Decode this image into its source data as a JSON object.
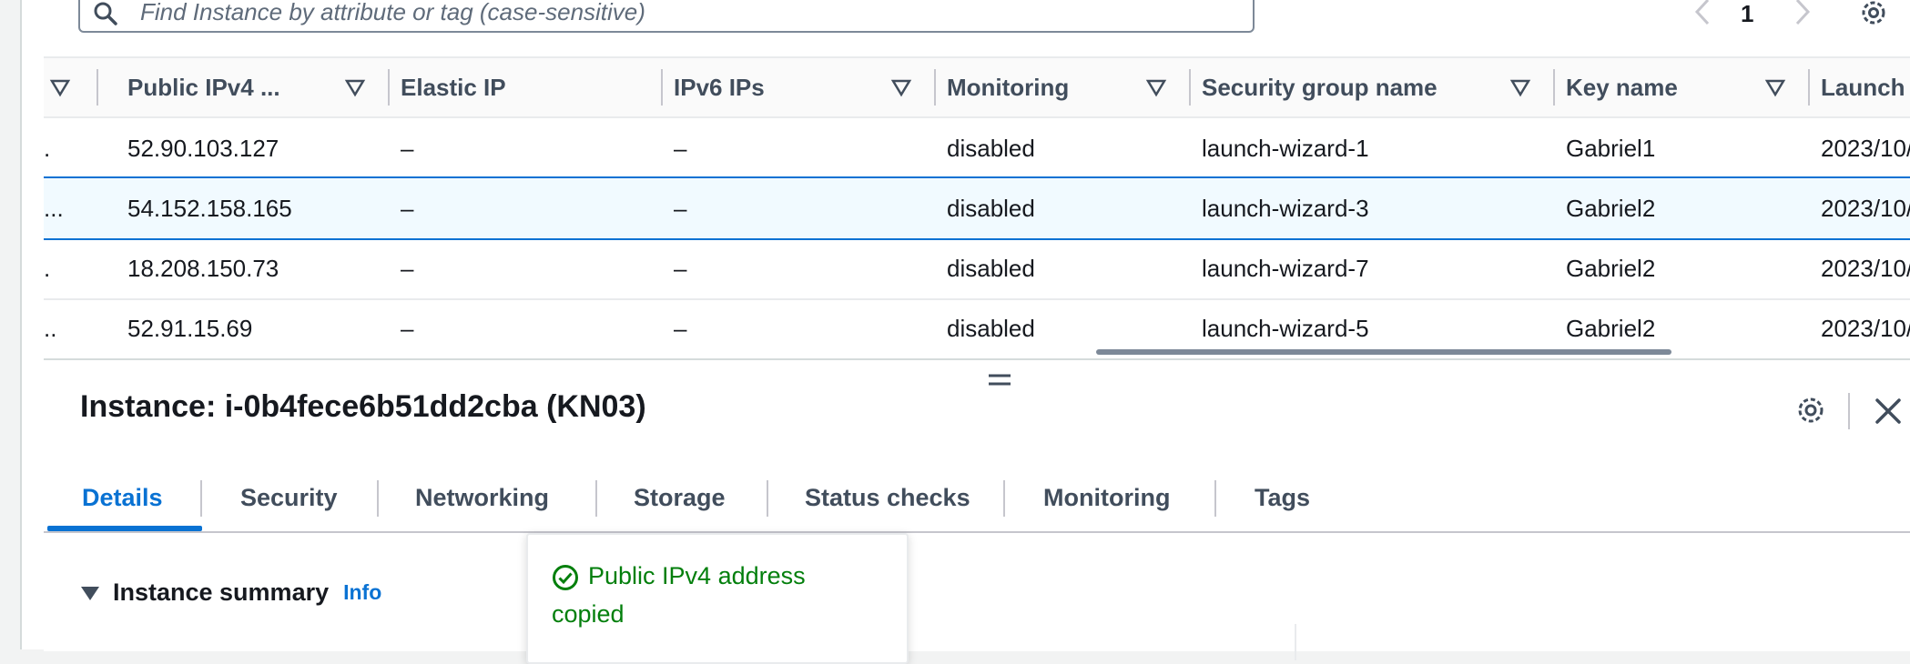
{
  "search": {
    "placeholder": "Find Instance by attribute or tag (case-sensitive)"
  },
  "pagination": {
    "current_page": "1"
  },
  "table": {
    "columns": [
      {
        "label": ""
      },
      {
        "label": "Public IPv4 ..."
      },
      {
        "label": "Elastic IP"
      },
      {
        "label": "IPv6 IPs"
      },
      {
        "label": "Monitoring"
      },
      {
        "label": "Security group name"
      },
      {
        "label": "Key name"
      },
      {
        "label": "Launch ti"
      }
    ],
    "rows": [
      {
        "truncated": ".",
        "public_ipv4": "52.90.103.127",
        "elastic_ip": "–",
        "ipv6": "–",
        "monitoring": "disabled",
        "security_group": "launch-wizard-1",
        "key_name": "Gabriel1",
        "launch_time": "2023/10/",
        "selected": false
      },
      {
        "truncated": "...",
        "public_ipv4": "54.152.158.165",
        "elastic_ip": "–",
        "ipv6": "–",
        "monitoring": "disabled",
        "security_group": "launch-wizard-3",
        "key_name": "Gabriel2",
        "launch_time": "2023/10/",
        "selected": true
      },
      {
        "truncated": ".",
        "public_ipv4": "18.208.150.73",
        "elastic_ip": "–",
        "ipv6": "–",
        "monitoring": "disabled",
        "security_group": "launch-wizard-7",
        "key_name": "Gabriel2",
        "launch_time": "2023/10/",
        "selected": false
      },
      {
        "truncated": "..",
        "public_ipv4": "52.91.15.69",
        "elastic_ip": "–",
        "ipv6": "–",
        "monitoring": "disabled",
        "security_group": "launch-wizard-5",
        "key_name": "Gabriel2",
        "launch_time": "2023/10/",
        "selected": false
      }
    ]
  },
  "panel": {
    "title": "Instance: i-0b4fece6b51dd2cba (KN03)",
    "tabs": [
      "Details",
      "Security",
      "Networking",
      "Storage",
      "Status checks",
      "Monitoring",
      "Tags"
    ],
    "active_tab": "Details",
    "summary_label": "Instance summary",
    "info_link": "Info"
  },
  "toast": {
    "message": "Public IPv4 address copied"
  },
  "colors": {
    "accent": "#0972d3",
    "success": "#037f0c",
    "text": "#16191f",
    "muted": "#414d5c"
  },
  "icons": [
    "search-icon",
    "chevron-left-icon",
    "chevron-right-icon",
    "gear-icon",
    "sort-icon",
    "drag-handle-icon",
    "close-icon",
    "caret-down-icon",
    "check-circle-icon"
  ]
}
